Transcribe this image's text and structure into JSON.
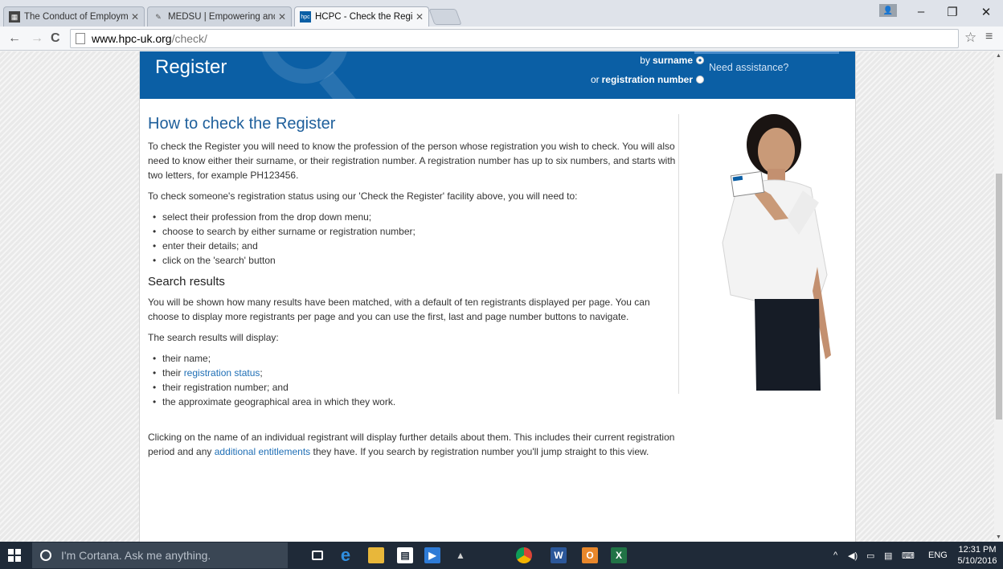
{
  "browser": {
    "tabs": [
      {
        "title": "The Conduct of Employm",
        "active": false
      },
      {
        "title": "MEDSU | Empowering and",
        "active": false
      },
      {
        "title": "HCPC - Check the Registe",
        "active": true
      }
    ],
    "url_host": "www.hpc-uk.org",
    "url_path": "/check/"
  },
  "banner": {
    "title": "Register",
    "search_by_prefix": "by",
    "search_by_surname": "surname",
    "search_or_prefix": "or",
    "search_by_regnum": "registration number",
    "assistance": "Need assistance?"
  },
  "content": {
    "heading": "How to check the Register",
    "intro": "To check the Register you will need to know the profession of the person whose registration you wish to check. You will also need to know either their surname, or their registration number. A registration number has up to six numbers, and starts with two letters, for example PH123456.",
    "status_intro": "To check someone's registration status using our 'Check the Register' facility above, you will need to:",
    "steps": [
      "select their profession from the drop down menu;",
      "choose to search by either surname or registration number;",
      "enter their details; and",
      "click on the 'search' button"
    ],
    "results_heading": "Search results",
    "results_intro": "You will be shown how many results have been matched, with a default of ten registrants displayed per page. You can choose to display more registrants per page and you can use the first, last and page number buttons to navigate.",
    "results_display": "The search results will display:",
    "results_item_1": "their name;",
    "results_item_2_prefix": "their",
    "results_item_2_link": "registration status",
    "results_item_2_suffix": ";",
    "results_item_3": "their registration number; and",
    "results_item_4": "the approximate geographical area in which they work.",
    "closing_part1": "Clicking on the name of an individual registrant will display further details about them. This includes their current registration period and any",
    "closing_link": "additional entitlements",
    "closing_part2": "they have. If you search by registration number you'll jump straight to this view."
  },
  "taskbar": {
    "cortana_placeholder": "I'm Cortana. Ask me anything.",
    "lang": "ENG",
    "time": "12:31 PM",
    "date": "5/10/2016"
  },
  "colors": {
    "banner_blue": "#0b5fa5",
    "heading_blue": "#1e5f9b",
    "link_blue": "#1e6eb5",
    "taskbar": "#1f2a38"
  }
}
